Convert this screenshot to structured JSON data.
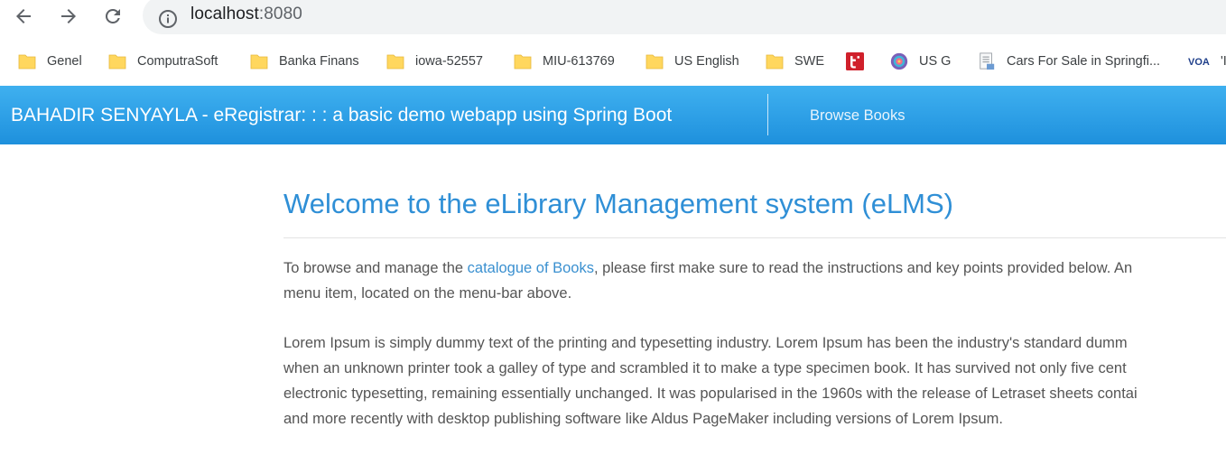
{
  "browser": {
    "url_host": "localhost",
    "url_port": ":8080"
  },
  "bookmarks": [
    {
      "label": "Genel",
      "icon": "folder-icon"
    },
    {
      "label": "ComputraSoft",
      "icon": "folder-icon"
    },
    {
      "label": "Banka Finans",
      "icon": "folder-icon"
    },
    {
      "label": "iowa-52557",
      "icon": "folder-icon"
    },
    {
      "label": "MIU-613769",
      "icon": "folder-icon"
    },
    {
      "label": "US English",
      "icon": "folder-icon"
    },
    {
      "label": "SWE",
      "icon": "folder-icon"
    },
    {
      "label": "",
      "icon": "red-t-icon"
    },
    {
      "label": "US G",
      "icon": "colorful-logo-icon"
    },
    {
      "label": "Cars For Sale in Springfi...",
      "icon": "document-icon"
    },
    {
      "label": "'I",
      "icon": "voa-icon"
    }
  ],
  "app": {
    "brand": "BAHADIR SENYAYLA - eRegistrar: : : a basic demo webapp using Spring Boot",
    "nav_link": "Browse Books"
  },
  "main": {
    "title": "Welcome to the eLibrary Management system (eLMS)",
    "intro": {
      "before_link": "To browse and manage the ",
      "link": "catalogue of Books",
      "after_link": ", please first make sure to read the instructions and key points provided below. An",
      "line2": "menu item, located on the menu-bar above."
    },
    "lorem_lines": [
      "Lorem Ipsum is simply dummy text of the printing and typesetting industry. Lorem Ipsum has been the industry's standard dumm",
      "when an unknown printer took a galley of type and scrambled it to make a type specimen book. It has survived not only five cent",
      "electronic typesetting, remaining essentially unchanged. It was popularised in the 1960s with the release of Letraset sheets contai",
      "and more recently with desktop publishing software like Aldus PageMaker including versions of Lorem Ipsum."
    ]
  }
}
